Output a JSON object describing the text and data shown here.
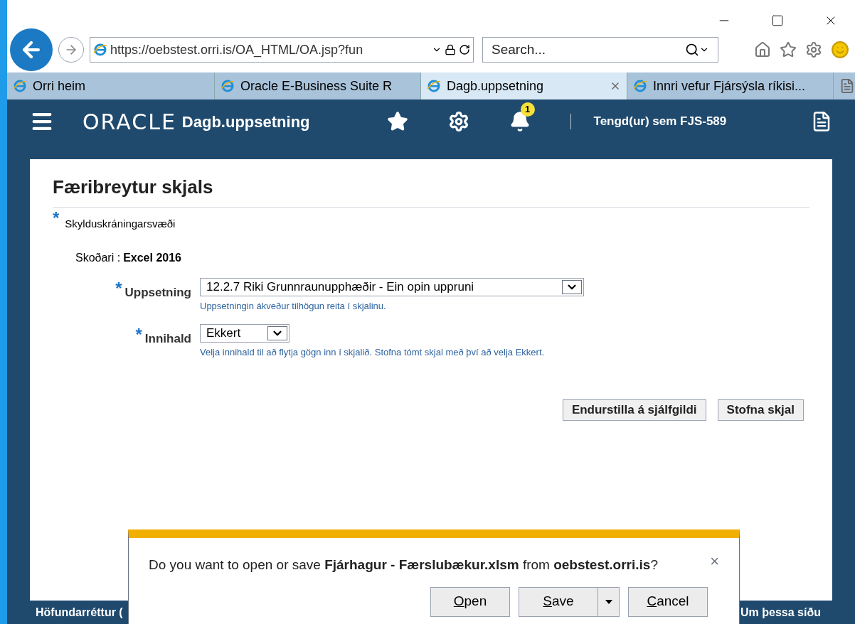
{
  "browser": {
    "address": "https://oebstest.orri.is/OA_HTML/OA.jsp?fun",
    "search_placeholder": "Search...",
    "tabs": [
      {
        "label": "Orri heim",
        "selected": false,
        "closable": false
      },
      {
        "label": "Oracle E-Business Suite R",
        "selected": false,
        "closable": false
      },
      {
        "label": "Dagb.uppsetning",
        "selected": true,
        "closable": true
      },
      {
        "label": "Innri vefur Fjársýsla ríkisi...",
        "selected": false,
        "closable": false
      }
    ]
  },
  "header": {
    "logo": "ORACLE",
    "title": "Dagb.uppsetning",
    "notification_count": "1",
    "user": "Tengd(ur) sem FJS-589"
  },
  "page": {
    "title": "Færibreytur skjals",
    "required_marker": "*",
    "required_note": "Skylduskráningarsvæði",
    "viewer_label": "Skoðari :",
    "viewer_value": "Excel 2016",
    "fields": [
      {
        "label": "Uppsetning",
        "value": "12.2.7 Riki Grunnraunupphæðir - Ein opin uppruni",
        "hint": "Uppsetningin ákveður tilhögun reita í skjalinu.",
        "required": true,
        "wide": true
      },
      {
        "label": "Innihald",
        "value": "Ekkert",
        "hint": "Velja innihald til að flytja gögn inn í skjalið. Stofna tómt skjal með því að velja Ekkert.",
        "required": true,
        "wide": false
      }
    ],
    "buttons": [
      "Endurstilla á sjálfgildi",
      "Stofna skjal"
    ]
  },
  "footer": {
    "left": "Höfundarréttur (",
    "right": "Um þessa síðu"
  },
  "download_bar": {
    "message": "Do you want to open or save **Fjárhagur - Færslubækur.xlsm** from **oebstest.orri.is**?",
    "close": "×",
    "buttons": [
      "Open",
      "Save",
      "Cancel"
    ]
  }
}
